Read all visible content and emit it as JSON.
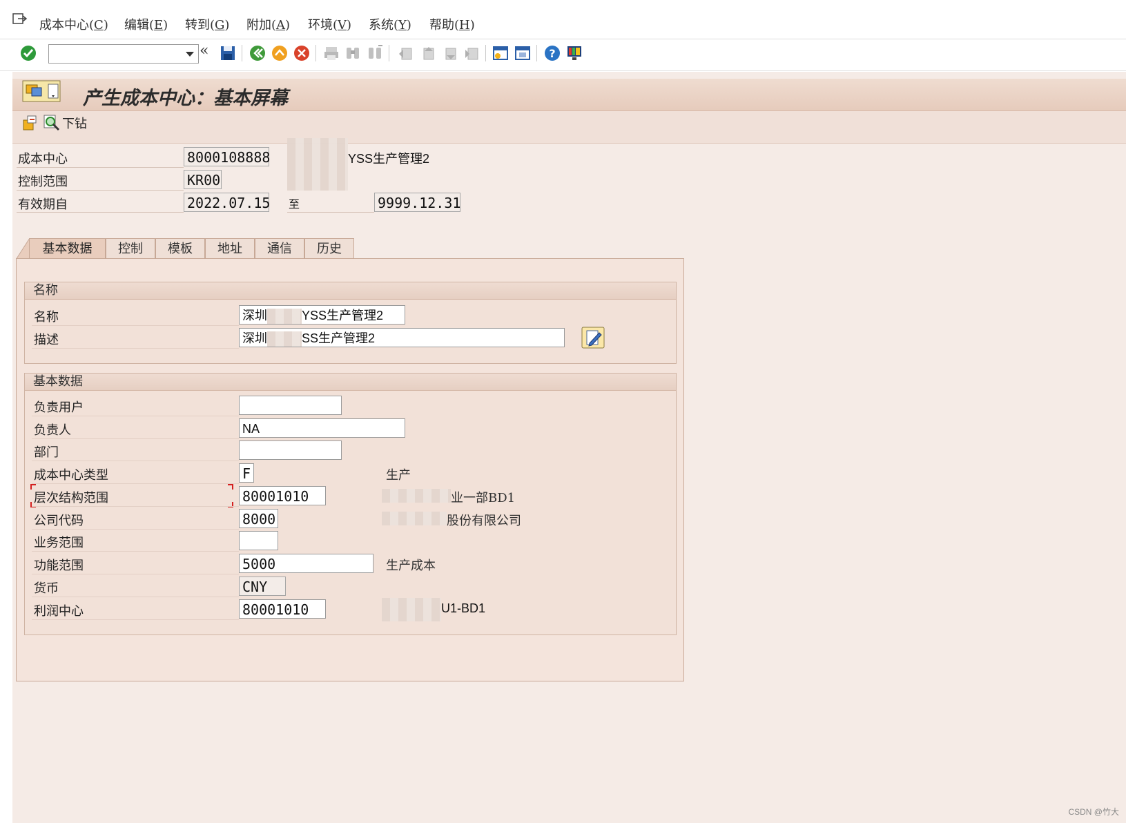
{
  "menu": {
    "items": [
      {
        "label": "成本中心(",
        "key": "C",
        "suffix": ")"
      },
      {
        "label": "编辑(",
        "key": "E",
        "suffix": ")"
      },
      {
        "label": "转到(",
        "key": "G",
        "suffix": ")"
      },
      {
        "label": "附加(",
        "key": "A",
        "suffix": ")"
      },
      {
        "label": "环境(",
        "key": "V",
        "suffix": ")"
      },
      {
        "label": "系统(",
        "key": "Y",
        "suffix": ")"
      },
      {
        "label": "帮助(",
        "key": "H",
        "suffix": ")"
      }
    ]
  },
  "toolbar": {
    "command_value": "",
    "icons": [
      "enter-icon",
      "back-double-icon",
      "save-icon",
      "back-icon",
      "exit-icon",
      "cancel-icon",
      "print-icon",
      "find-icon",
      "find-next-icon",
      "first-page-icon",
      "prev-page-icon",
      "next-page-icon",
      "last-page-icon",
      "new-session-icon",
      "shortcut-icon",
      "help-icon",
      "layout-icon"
    ]
  },
  "title": "产生成本中心：基本屏幕",
  "app_toolbar": {
    "drilldown_label": "下钻"
  },
  "header": {
    "cost_center_label": "成本中心",
    "cost_center_value": "8000108888",
    "cost_center_desc": "YSS生产管理2",
    "controlling_area_label": "控制范围",
    "controlling_area_value": "KR00",
    "valid_from_label": "有效期自",
    "valid_from_value": "2022.07.15",
    "to_label": "至",
    "valid_to_value": "9999.12.31"
  },
  "tabs": [
    "基本数据",
    "控制",
    "模板",
    "地址",
    "通信",
    "历史"
  ],
  "names_group": {
    "title": "名称",
    "name_label": "名称",
    "name_value_prefix": "深圳",
    "name_value_suffix": "YSS生产管理2",
    "desc_label": "描述",
    "desc_value_prefix": "深圳",
    "desc_value_suffix": "SS生产管理2"
  },
  "basic_group": {
    "title": "基本数据",
    "rows": {
      "user_responsible": {
        "label": "负责用户",
        "value": ""
      },
      "person_responsible": {
        "label": "负责人",
        "value": "NA"
      },
      "department": {
        "label": "部门",
        "value": ""
      },
      "category": {
        "label": "成本中心类型",
        "value": "F",
        "desc": "生产"
      },
      "hierarchy": {
        "label": "层次结构范围",
        "value": "80001010",
        "desc": "业一部BD1"
      },
      "company": {
        "label": "公司代码",
        "value": "8000",
        "desc": "股份有限公司"
      },
      "business_area": {
        "label": "业务范围",
        "value": ""
      },
      "functional_area": {
        "label": "功能范围",
        "value": "5000",
        "desc": "生产成本"
      },
      "currency": {
        "label": "货币",
        "value": "CNY"
      },
      "profit_center": {
        "label": "利润中心",
        "value": "80001010",
        "desc": "U1-BD1"
      }
    }
  },
  "footer": {
    "watermark": "CSDN @竹大"
  }
}
